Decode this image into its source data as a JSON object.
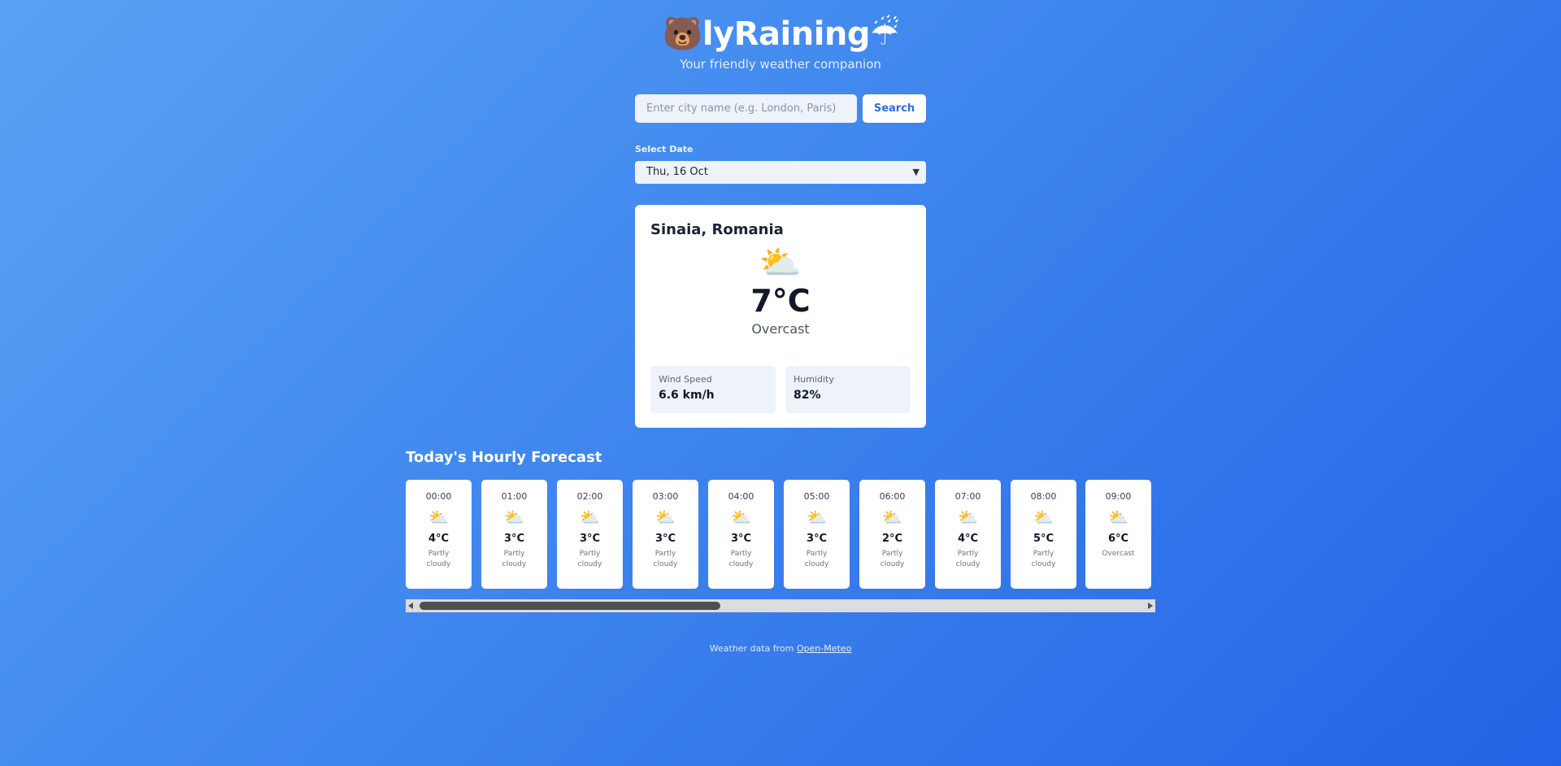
{
  "header": {
    "logo_left_emoji": "🐻",
    "title": "lyRaining",
    "logo_right_emoji": "☔",
    "tagline": "Your friendly weather companion"
  },
  "search": {
    "placeholder": "Enter city name (e.g. London, Paris)",
    "value": "",
    "button_label": "Search"
  },
  "date": {
    "label": "Select Date",
    "selected": "Thu, 16 Oct"
  },
  "current": {
    "location": "Sinaia, Romania",
    "icon": "⛅",
    "temperature": "7°C",
    "condition": "Overcast",
    "wind_label": "Wind Speed",
    "wind_value": "6.6 km/h",
    "humidity_label": "Humidity",
    "humidity_value": "82%"
  },
  "hourly": {
    "title": "Today's Hourly Forecast",
    "items": [
      {
        "time": "00:00",
        "icon": "⛅",
        "temp": "4°C",
        "cond": "Partly cloudy"
      },
      {
        "time": "01:00",
        "icon": "⛅",
        "temp": "3°C",
        "cond": "Partly cloudy"
      },
      {
        "time": "02:00",
        "icon": "⛅",
        "temp": "3°C",
        "cond": "Partly cloudy"
      },
      {
        "time": "03:00",
        "icon": "⛅",
        "temp": "3°C",
        "cond": "Partly cloudy"
      },
      {
        "time": "04:00",
        "icon": "⛅",
        "temp": "3°C",
        "cond": "Partly cloudy"
      },
      {
        "time": "05:00",
        "icon": "⛅",
        "temp": "3°C",
        "cond": "Partly cloudy"
      },
      {
        "time": "06:00",
        "icon": "⛅",
        "temp": "2°C",
        "cond": "Partly cloudy"
      },
      {
        "time": "07:00",
        "icon": "⛅",
        "temp": "4°C",
        "cond": "Partly cloudy"
      },
      {
        "time": "08:00",
        "icon": "⛅",
        "temp": "5°C",
        "cond": "Partly cloudy"
      },
      {
        "time": "09:00",
        "icon": "⛅",
        "temp": "6°C",
        "cond": "Overcast"
      }
    ]
  },
  "footer": {
    "text": "Weather data from ",
    "link_label": "Open-Meteo"
  }
}
